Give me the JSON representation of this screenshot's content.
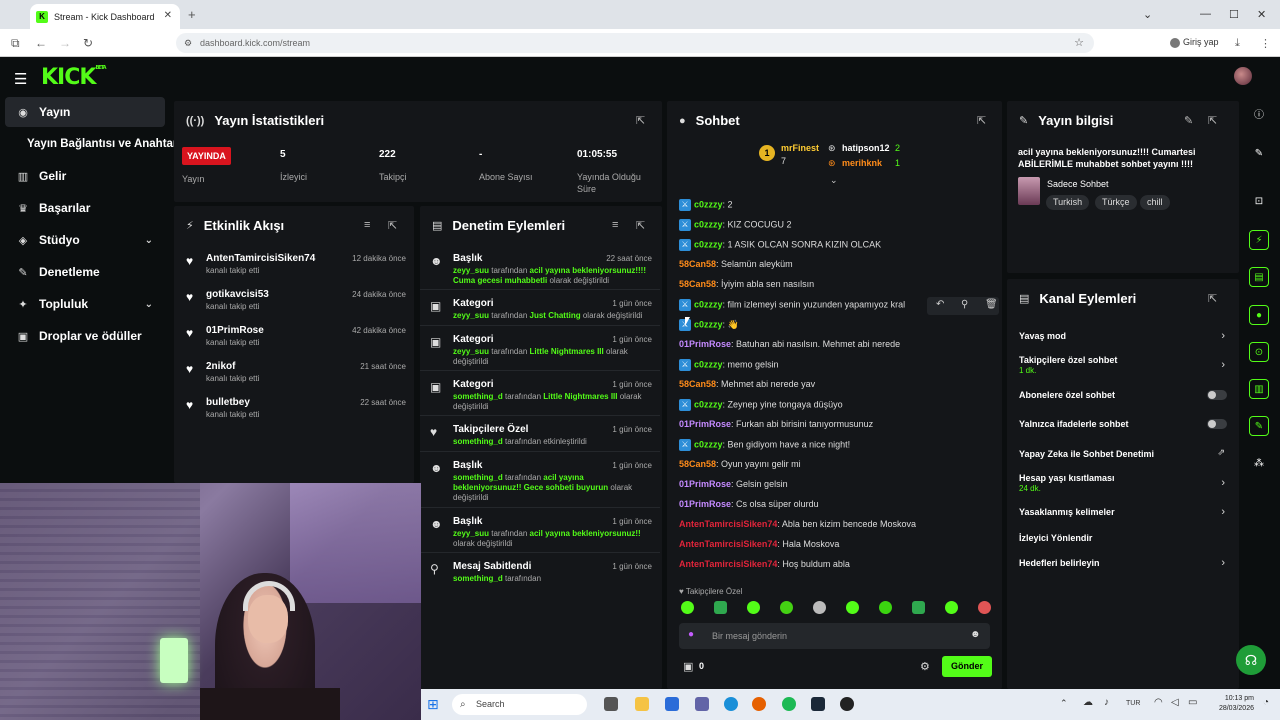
{
  "browser": {
    "tab_title": "Stream - Kick Dashboard",
    "url": "dashboard.kick.com/stream",
    "signin_label": "Giriş yap"
  },
  "kick": {
    "logo": "KICK",
    "logo_sup": "BETA"
  },
  "sidebar": {
    "items": [
      {
        "label": "Yayın",
        "icon": "signal-icon"
      },
      {
        "label": "Yayın Bağlantısı ve Anahtarı",
        "icon": ""
      },
      {
        "label": "Gelir",
        "icon": "chart-icon"
      },
      {
        "label": "Başarılar",
        "icon": "trophy-icon"
      },
      {
        "label": "Stüdyo",
        "icon": "studio-icon"
      },
      {
        "label": "Denetleme",
        "icon": "wrench-icon"
      },
      {
        "label": "Topluluk",
        "icon": "community-icon"
      },
      {
        "label": "Droplar ve ödüller",
        "icon": "gift-icon"
      }
    ]
  },
  "stats": {
    "title": "Yayın İstatistikleri",
    "live_badge": "YAYINDA",
    "stream_label": "Yayın",
    "items": [
      {
        "value": "5",
        "label": "İzleyici"
      },
      {
        "value": "222",
        "label": "Takipçi"
      },
      {
        "value": "-",
        "label": "Abone Sayısı"
      },
      {
        "value": "01:05:55",
        "label": "Yayında Olduğu Süre"
      }
    ]
  },
  "activity": {
    "title": "Etkinlik Akışı",
    "items": [
      {
        "name": "AntenTamircisiSiken74",
        "sub": "kanalı takip etti",
        "time": "12 dakika önce"
      },
      {
        "name": "gotikavcisi53",
        "sub": "kanalı takip etti",
        "time": "24 dakika önce"
      },
      {
        "name": "01PrimRose",
        "sub": "kanalı takip etti",
        "time": "42 dakika önce"
      },
      {
        "name": "2nikof",
        "sub": "kanalı takip etti",
        "time": "21 saat önce"
      },
      {
        "name": "bulletbey",
        "sub": "kanalı takip etti",
        "time": "22 saat önce"
      }
    ]
  },
  "moderation": {
    "title": "Denetim Eylemleri",
    "items": [
      {
        "title": "Başlık",
        "time": "22 saat önce",
        "user": "zeyy_suu",
        "mid": " tarafından ",
        "val": "acil yayına bekleniyorsunuz!!!! Cuma gecesi muhabbetli",
        "end": " olarak değiştirildi"
      },
      {
        "title": "Kategori",
        "time": "1 gün önce",
        "user": "zeyy_suu",
        "mid": " tarafından ",
        "val": "Just Chatting",
        "end": " olarak değiştirildi"
      },
      {
        "title": "Kategori",
        "time": "1 gün önce",
        "user": "zeyy_suu",
        "mid": " tarafından ",
        "val": "Little Nightmares III",
        "end": " olarak değiştirildi"
      },
      {
        "title": "Kategori",
        "time": "1 gün önce",
        "user": "something_d",
        "mid": " tarafından ",
        "val": "Little Nightmares III",
        "end": " olarak değiştirildi"
      },
      {
        "title": "Takipçilere Özel",
        "time": "1 gün önce",
        "user": "something_d",
        "mid": " tarafından etkinleştirildi",
        "val": "",
        "end": ""
      },
      {
        "title": "Başlık",
        "time": "1 gün önce",
        "user": "something_d",
        "mid": " tarafından ",
        "val": "acil yayına bekleniyorsunuz!! Gece sohbeti buyurun",
        "end": " olarak değiştirildi"
      },
      {
        "title": "Başlık",
        "time": "1 gün önce",
        "user": "zeyy_suu",
        "mid": " tarafından ",
        "val": "acil yayına bekleniyorsunuz!!",
        "end": " olarak değiştirildi"
      },
      {
        "title": "Mesaj Sabitlendi",
        "time": "1 gün önce",
        "user": "something_d",
        "mid": " tarafından",
        "val": "",
        "end": ""
      }
    ]
  },
  "chat": {
    "title": "Sohbet",
    "top_gifters": [
      {
        "name": "mrFinest",
        "count": "7"
      },
      {
        "name": "hatipson12",
        "count": "2"
      },
      {
        "name": "merihknk",
        "count": "1"
      }
    ],
    "messages": [
      {
        "user": "c0zzzy",
        "color": "#53fc18",
        "badge": true,
        "text": "2"
      },
      {
        "user": "c0zzzy",
        "color": "#53fc18",
        "badge": true,
        "text": "KIZ COCUGU 2"
      },
      {
        "user": "c0zzzy",
        "color": "#53fc18",
        "badge": true,
        "text": "1 ASIK OLCAN SONRA KIZIN OLCAK"
      },
      {
        "user": "58Can58",
        "color": "#ff8c1a",
        "badge": false,
        "text": "Selamün aleyküm"
      },
      {
        "user": "58Can58",
        "color": "#ff8c1a",
        "badge": false,
        "text": "İyiyim abla sen nasılsın"
      },
      {
        "user": "c0zzzy",
        "color": "#53fc18",
        "badge": true,
        "text": "film izlemeyi senin yuzunden yapamıyoz kral"
      },
      {
        "user": "c0zzzy",
        "color": "#53fc18",
        "badge": true,
        "text": "👋"
      },
      {
        "user": "01PrimRose",
        "color": "#c58aff",
        "badge": false,
        "text": "Batuhan abi nasılsın. Mehmet abi nerede"
      },
      {
        "user": "c0zzzy",
        "color": "#53fc18",
        "badge": true,
        "text": "memo gelsin"
      },
      {
        "user": "58Can58",
        "color": "#ff8c1a",
        "badge": false,
        "text": "Mehmet abi nerede yav"
      },
      {
        "user": "c0zzzy",
        "color": "#53fc18",
        "badge": true,
        "text": "Zeynep yine tongaya düşüyo"
      },
      {
        "user": "01PrimRose",
        "color": "#c58aff",
        "badge": false,
        "text": "Furkan abi birisini tanıyormusunuz"
      },
      {
        "user": "c0zzzy",
        "color": "#53fc18",
        "badge": true,
        "text": "Ben gidiyom have a nice night!"
      },
      {
        "user": "58Can58",
        "color": "#ff8c1a",
        "badge": false,
        "text": "Oyun yayını gelir mi"
      },
      {
        "user": "01PrimRose",
        "color": "#c58aff",
        "badge": false,
        "text": "Gelsin gelsin"
      },
      {
        "user": "01PrimRose",
        "color": "#c58aff",
        "badge": false,
        "text": "Cs olsa süper olurdu"
      },
      {
        "user": "AntenTamircisiSiken74",
        "color": "#e0243a",
        "badge": false,
        "text": "Abla ben kizim bencede Moskova"
      },
      {
        "user": "AntenTamircisiSiken74",
        "color": "#e0243a",
        "badge": false,
        "text": "Hala Moskova"
      },
      {
        "user": "AntenTamircisiSiken74",
        "color": "#e0243a",
        "badge": false,
        "text": "Hoş buldum abla"
      }
    ],
    "followers_only": "Takipçilere Özel",
    "input_placeholder": "Bir mesaj gönderin",
    "send_label": "Gönder",
    "gift_count": "0"
  },
  "stream_info": {
    "title": "Yayın bilgisi",
    "stream_title": "acil yayına bekleniyorsunuz!!!! Cumartesi ABİLERİMLE muhabbet sohbet yayını !!!!",
    "category": "Sadece Sohbet",
    "tags": [
      "Turkish",
      "Türkçe",
      "chill"
    ]
  },
  "channel_actions": {
    "title": "Kanal Eylemleri",
    "items": [
      {
        "label": "Yavaş mod",
        "sub": "",
        "control": "arrow"
      },
      {
        "label": "Takipçilere özel sohbet",
        "sub": "1 dk.",
        "control": "arrow"
      },
      {
        "label": "Abonelere özel sohbet",
        "sub": "",
        "control": "toggle"
      },
      {
        "label": "Yalnızca ifadelerle sohbet",
        "sub": "",
        "control": "toggle"
      },
      {
        "label": "Yapay Zeka ile Sohbet Denetimi",
        "sub": "",
        "control": "external"
      },
      {
        "label": "Hesap yaşı kısıtlaması",
        "sub": "24 dk.",
        "control": "arrow"
      },
      {
        "label": "Yasaklanmış kelimeler",
        "sub": "",
        "control": "arrow"
      },
      {
        "label": "İzleyici Yönlendir",
        "sub": "",
        "control": "none"
      },
      {
        "label": "Hedefleri belirleyin",
        "sub": "",
        "control": "arrow"
      }
    ]
  },
  "taskbar": {
    "search_label": "Search",
    "lang": "TUR",
    "time": "10:13 pm",
    "date": "28/03/2026"
  },
  "colors": {
    "accent": "#53fc18",
    "live": "#d9141e",
    "panel": "#141619",
    "bg": "#0b0e0f"
  }
}
